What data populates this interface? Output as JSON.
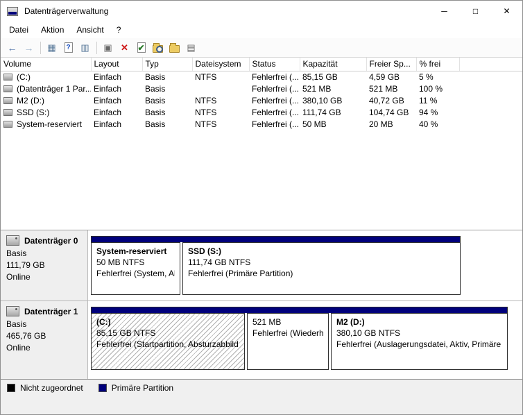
{
  "window": {
    "title": "Datenträgerverwaltung",
    "controls": {
      "minimize": "─",
      "maximize": "□",
      "close": "✕"
    }
  },
  "menubar": {
    "items": [
      "Datei",
      "Aktion",
      "Ansicht",
      "?"
    ]
  },
  "toolbar": {
    "icons": [
      "back-icon",
      "forward-icon",
      "show-console-tree-icon",
      "help-icon",
      "show-action-pane-icon",
      "context-menu-icon",
      "delete-volume-icon",
      "check-volume-icon",
      "explore-search-icon",
      "open-folder-icon",
      "view-options-icon"
    ]
  },
  "volume_table": {
    "columns": [
      "Volume",
      "Layout",
      "Typ",
      "Dateisystem",
      "Status",
      "Kapazität",
      "Freier Sp...",
      "% frei"
    ],
    "rows": [
      {
        "volume": "(C:)",
        "layout": "Einfach",
        "type": "Basis",
        "fs": "NTFS",
        "status": "Fehlerfrei (...",
        "capacity": "85,15 GB",
        "free": "4,59 GB",
        "pct": "5 %"
      },
      {
        "volume": "(Datenträger 1 Par...",
        "layout": "Einfach",
        "type": "Basis",
        "fs": "",
        "status": "Fehlerfrei (...",
        "capacity": "521 MB",
        "free": "521 MB",
        "pct": "100 %"
      },
      {
        "volume": "M2 (D:)",
        "layout": "Einfach",
        "type": "Basis",
        "fs": "NTFS",
        "status": "Fehlerfrei (...",
        "capacity": "380,10 GB",
        "free": "40,72 GB",
        "pct": "11 %"
      },
      {
        "volume": "SSD (S:)",
        "layout": "Einfach",
        "type": "Basis",
        "fs": "NTFS",
        "status": "Fehlerfrei (...",
        "capacity": "111,74 GB",
        "free": "104,74 GB",
        "pct": "94 %"
      },
      {
        "volume": "System-reserviert",
        "layout": "Einfach",
        "type": "Basis",
        "fs": "NTFS",
        "status": "Fehlerfrei (...",
        "capacity": "50 MB",
        "free": "20 MB",
        "pct": "40 %"
      }
    ]
  },
  "graph": {
    "disks": [
      {
        "name": "Datenträger 0",
        "type": "Basis",
        "size": "111,79 GB",
        "status": "Online",
        "partitions": [
          {
            "title": "System-reserviert",
            "size": "50 MB NTFS",
            "status": "Fehlerfrei (System, Akt"
          },
          {
            "title": "SSD  (S:)",
            "size": "111,74 GB NTFS",
            "status": "Fehlerfrei (Primäre Partition)"
          }
        ]
      },
      {
        "name": "Datenträger 1",
        "type": "Basis",
        "size": "465,76 GB",
        "status": "Online",
        "partitions": [
          {
            "title": "(C:)",
            "size": "85,15 GB NTFS",
            "status": "Fehlerfrei (Startpartition, Absturzabbild,"
          },
          {
            "title": "",
            "size": "521 MB",
            "status": "Fehlerfrei (Wiederher"
          },
          {
            "title": "M2  (D:)",
            "size": "380,10 GB NTFS",
            "status": "Fehlerfrei (Auslagerungsdatei, Aktiv, Primäre P"
          }
        ]
      }
    ]
  },
  "legend": {
    "items": [
      {
        "label": "Nicht zugeordnet",
        "color": "#000000"
      },
      {
        "label": "Primäre Partition",
        "color": "#00007b"
      }
    ]
  },
  "colors": {
    "primary_partition": "#00007b",
    "unallocated": "#000000"
  }
}
